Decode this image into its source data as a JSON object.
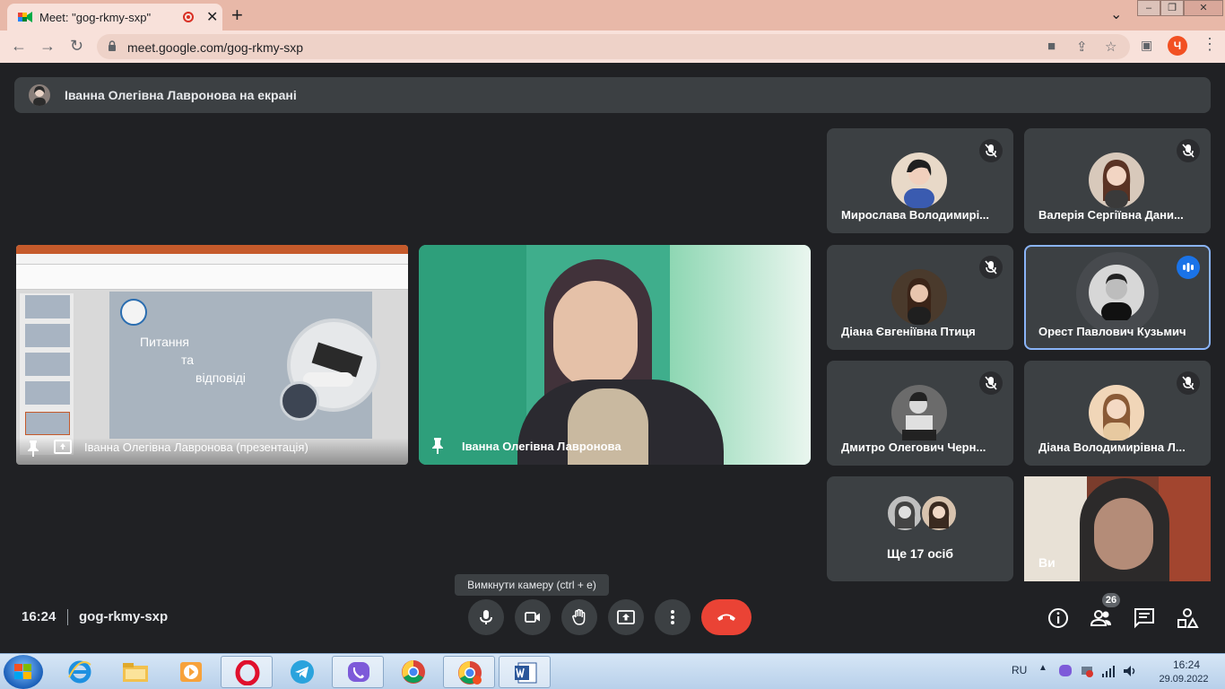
{
  "browser": {
    "tab_title": "Meet: \"gog-rkmy-sxp\"",
    "url": "meet.google.com/gog-rkmy-sxp",
    "profile_initial": "Ч",
    "accent": "#e8b8a8"
  },
  "meeting": {
    "presenting_banner": "Іванна Олегівна Лавронова на екрані",
    "time": "16:24",
    "code": "gog-rkmy-sxp",
    "tooltip": "Вимкнути камеру (ctrl + e)",
    "people_count": "26"
  },
  "presentation": {
    "slide_title_1": "Питання",
    "slide_title_2": "та",
    "slide_title_3": "відповіді",
    "label": "Іванна Олегівна Лавронова (презентація)"
  },
  "presenter_camera": {
    "name": "Іванна Олегівна Лавронова"
  },
  "participants": [
    {
      "name": "Мирослава Володимирі..."
    },
    {
      "name": "Валерія Сергіївна Дани..."
    },
    {
      "name": "Діана Євгеніївна Птиця"
    },
    {
      "name": "Орест Павлович Кузьмич"
    },
    {
      "name": "Дмитро Олегович Черн..."
    },
    {
      "name": "Діана Володимирівна Л..."
    },
    {
      "name": "Ще 17 осіб"
    },
    {
      "name": "Ви"
    }
  ],
  "taskbar": {
    "lang": "RU",
    "time": "16:24",
    "date": "29.09.2022"
  },
  "colors": {
    "meet_bg": "#202124",
    "tile_bg": "#3c4043",
    "end_call": "#ea4335",
    "speaking_border": "#8ab4f8",
    "speaking_badge": "#1a73e8"
  }
}
